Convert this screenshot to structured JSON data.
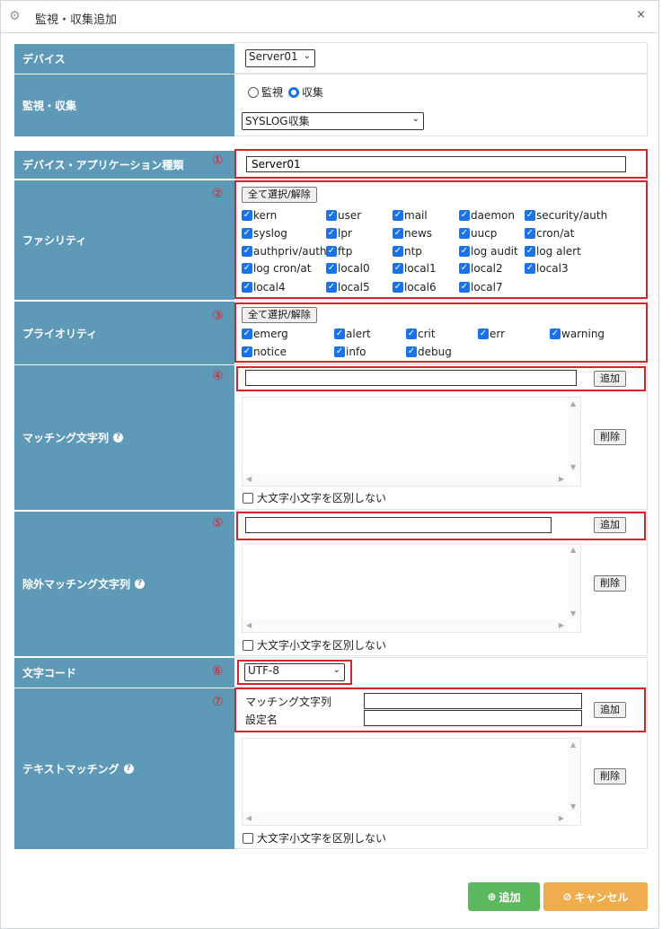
{
  "dialog": {
    "title": "監視・収集追加",
    "close": "×"
  },
  "rows": {
    "device": {
      "label": "デバイス",
      "value": "Server01"
    },
    "monitor": {
      "label": "監視・収集",
      "radio1": "監視",
      "radio2": "収集",
      "select": "SYSLOG収集"
    },
    "app_type": {
      "label": "デバイス・アプリケーション種類",
      "num": "①",
      "value": "Server01"
    },
    "facility": {
      "label": "ファシリティ",
      "num": "②",
      "select_all": "全て選択/解除",
      "items": [
        "kern",
        "user",
        "mail",
        "daemon",
        "security/auth",
        "syslog",
        "lpr",
        "news",
        "uucp",
        "cron/at",
        "authpriv/auth",
        "ftp",
        "ntp",
        "log audit",
        "log alert",
        "log cron/at",
        "local0",
        "local1",
        "local2",
        "local3",
        "local4",
        "local5",
        "local6",
        "local7"
      ]
    },
    "priority": {
      "label": "プライオリティ",
      "num": "③",
      "select_all": "全て選択/解除",
      "items": [
        "emerg",
        "alert",
        "crit",
        "err",
        "warning",
        "notice",
        "info",
        "debug"
      ]
    },
    "match": {
      "label": "マッチング文字列",
      "num": "④",
      "add": "追加",
      "delete": "削除",
      "case": "大文字小文字を区別しない"
    },
    "exclude": {
      "label": "除外マッチング文字列",
      "num": "⑤",
      "add": "追加",
      "delete": "削除",
      "case": "大文字小文字を区別しない"
    },
    "charset": {
      "label": "文字コード",
      "num": "⑥",
      "value": "UTF-8"
    },
    "textmatch": {
      "label": "テキストマッチング",
      "num": "⑦",
      "field1": "マッチング文字列",
      "field2": "設定名",
      "add": "追加",
      "delete": "削除",
      "case": "大文字小文字を区別しない"
    }
  },
  "footer": {
    "add": "追加",
    "cancel": "キャンセル"
  },
  "colors": {
    "label_bg": "#5f99b8",
    "red": "#d9232a",
    "green": "#5cb85c",
    "orange": "#f0ad4e"
  }
}
